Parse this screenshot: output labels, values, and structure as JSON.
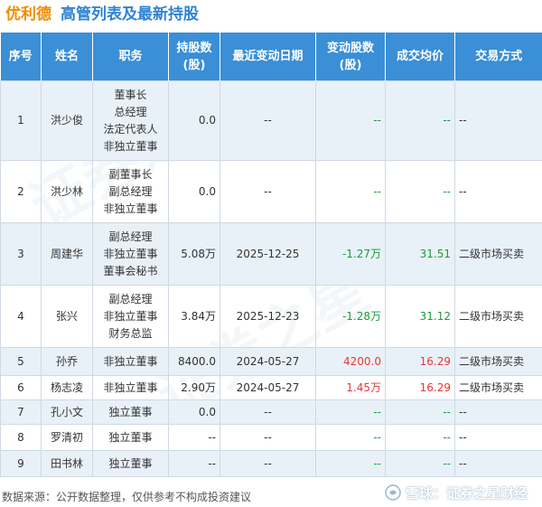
{
  "title": {
    "company": "优利德",
    "subject": "高管列表及最新持股"
  },
  "table": {
    "headers": [
      "序号",
      "姓名",
      "职务",
      "持股数\n(股)",
      "最近变动日期",
      "变动股数\n(股)",
      "成交均价",
      "交易方式"
    ],
    "rows": [
      {
        "no": "1",
        "name": "洪少俊",
        "duties": [
          "董事长",
          "总经理",
          "法定代表人",
          "非独立董事"
        ],
        "shares": "0.0",
        "date": "--",
        "change": "--",
        "price": "--",
        "method": "--"
      },
      {
        "no": "2",
        "name": "洪少林",
        "duties": [
          "副董事长",
          "副总经理",
          "非独立董事"
        ],
        "shares": "0.0",
        "date": "--",
        "change": "--",
        "price": "--",
        "method": "--"
      },
      {
        "no": "3",
        "name": "周建华",
        "duties": [
          "副总经理",
          "非独立董事",
          "董事会秘书"
        ],
        "shares": "5.08万",
        "date": "2025-12-25",
        "change": "-1.27万",
        "price": "31.51",
        "method": "二级市场买卖"
      },
      {
        "no": "4",
        "name": "张兴",
        "duties": [
          "副总经理",
          "非独立董事",
          "财务总监"
        ],
        "shares": "3.84万",
        "date": "2025-12-23",
        "change": "-1.28万",
        "price": "31.12",
        "method": "二级市场买卖"
      },
      {
        "no": "5",
        "name": "孙乔",
        "duties": [
          "非独立董事"
        ],
        "shares": "8400.0",
        "date": "2024-05-27",
        "change": "4200.0",
        "price": "16.29",
        "method": "二级市场买卖"
      },
      {
        "no": "6",
        "name": "杨志凌",
        "duties": [
          "非独立董事"
        ],
        "shares": "2.90万",
        "date": "2024-05-27",
        "change": "1.45万",
        "price": "16.29",
        "method": "二级市场买卖"
      },
      {
        "no": "7",
        "name": "孔小文",
        "duties": [
          "独立董事"
        ],
        "shares": "0.0",
        "date": "--",
        "change": "--",
        "price": "--",
        "method": "--"
      },
      {
        "no": "8",
        "name": "罗清初",
        "duties": [
          "独立董事"
        ],
        "shares": "--",
        "date": "--",
        "change": "--",
        "price": "--",
        "method": "--"
      },
      {
        "no": "9",
        "name": "田书林",
        "duties": [
          "独立董事"
        ],
        "shares": "--",
        "date": "--",
        "change": "--",
        "price": "--",
        "method": "--"
      }
    ]
  },
  "footer": {
    "source": "数据来源：公开数据整理，仅供参考不构成投资建议"
  },
  "brand": {
    "text": "雪球：证券之星财经"
  },
  "colors": {
    "header_bg": "#3a8fd6",
    "title": "#2f83d3",
    "company": "#f08c00",
    "negative": "#1a9c3a",
    "positive": "#e53935",
    "stripe": "#e9f1f8"
  },
  "icons": {
    "brand_logo": "snowball-icon"
  }
}
